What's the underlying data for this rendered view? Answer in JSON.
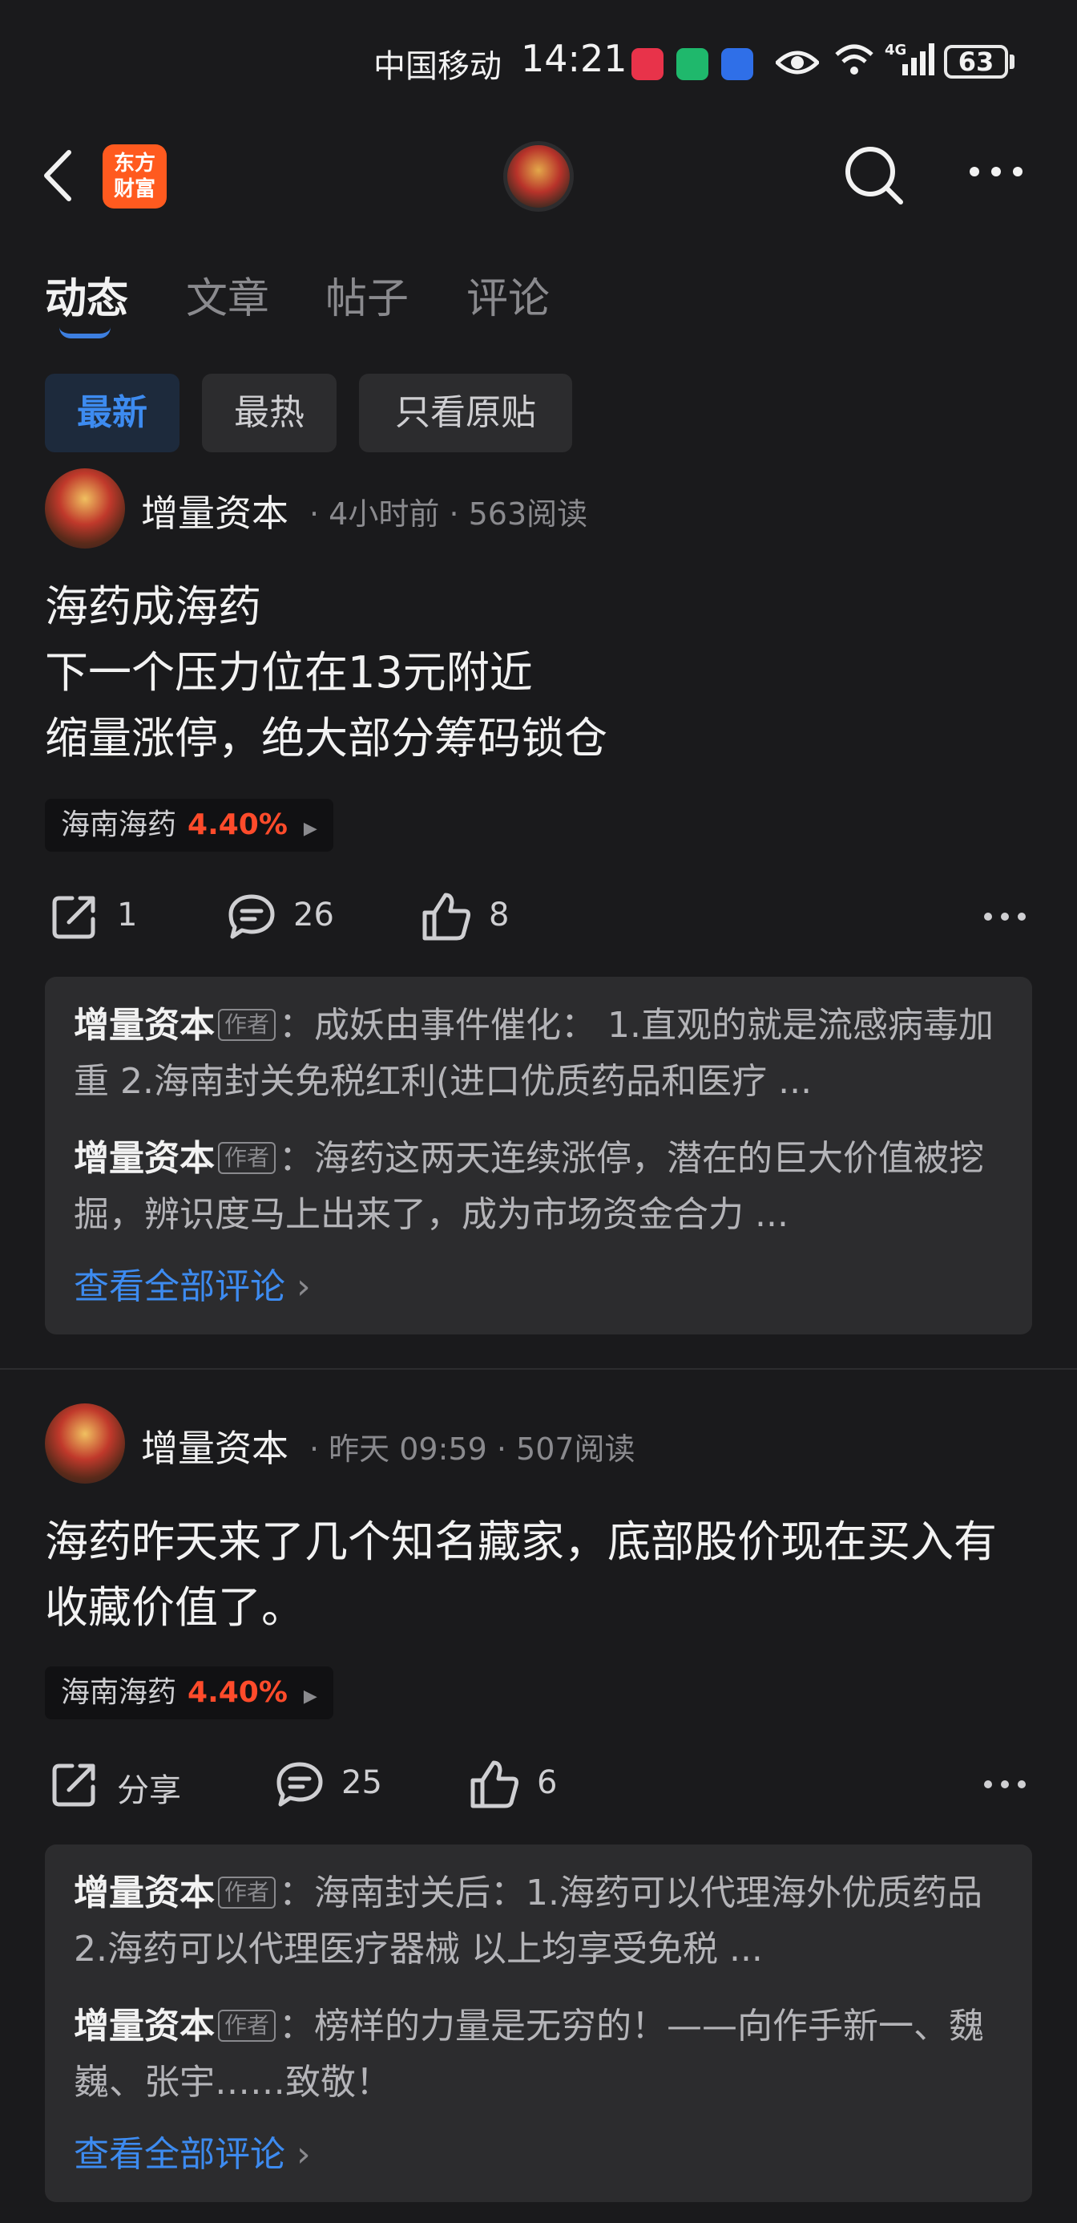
{
  "status": {
    "carrier": "中国移动",
    "time": "14:21",
    "network": "4G",
    "battery": "63"
  },
  "header": {
    "logo_text": "东方\n财富"
  },
  "tabs": [
    {
      "label": "动态",
      "active": true
    },
    {
      "label": "文章",
      "active": false
    },
    {
      "label": "帖子",
      "active": false
    },
    {
      "label": "评论",
      "active": false
    }
  ],
  "filters": [
    {
      "label": "最新",
      "active": true
    },
    {
      "label": "最热",
      "active": false
    },
    {
      "label": "只看原贴",
      "active": false
    }
  ],
  "posts": [
    {
      "author": "增量资本",
      "time": "4小时前",
      "reads": "563阅读",
      "text": "海药成海药\n下一个压力位在13元附近\n缩量涨停，绝大部分筹码锁仓",
      "stock": {
        "name": "海南海药",
        "change": "4.40%"
      },
      "share_label": "1",
      "comments": "26",
      "likes": "8",
      "comment_list": [
        {
          "author": "增量资本",
          "badge": "作者",
          "text": "：成妖由事件催化：  1.直观的就是流感病毒加重  2.海南封关免税红利(进口优质药品和医疗 ..."
        },
        {
          "author": "增量资本",
          "badge": "作者",
          "text": "：海药这两天连续涨停，潜在的巨大价值被挖掘，辨识度马上出来了，成为市场资金合力  ..."
        }
      ],
      "view_all": "查看全部评论"
    },
    {
      "author": "增量资本",
      "time": "昨天 09:59",
      "reads": "507阅读",
      "text": "海药昨天来了几个知名藏家，底部股价现在买入有收藏价值了。",
      "stock": {
        "name": "海南海药",
        "change": "4.40%"
      },
      "share_label": "分享",
      "comments": "25",
      "likes": "6",
      "comment_list": [
        {
          "author": "增量资本",
          "badge": "作者",
          "text": "：海南封关后：1.海药可以代理海外优质药品  2.海药可以代理医疗器械  以上均享受免税  ..."
        },
        {
          "author": "增量资本",
          "badge": "作者",
          "text": "：榜样的力量是无穷的！——向作手新一、魏巍、张宇……致敬！"
        }
      ],
      "view_all": "查看全部评论"
    }
  ]
}
